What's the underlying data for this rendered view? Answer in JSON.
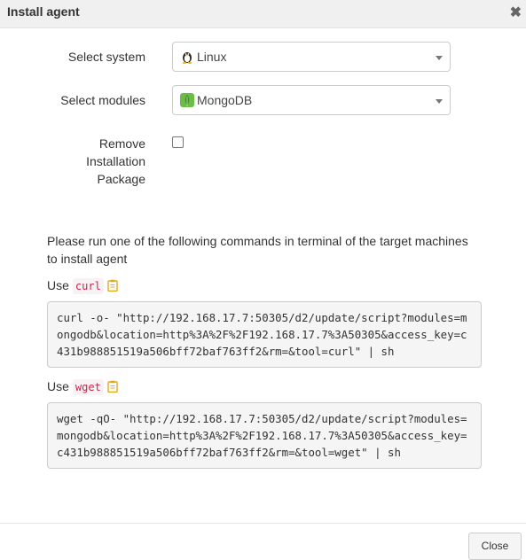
{
  "dialog": {
    "title": "Install agent",
    "close_icon": "close-icon"
  },
  "form": {
    "system_label": "Select system",
    "system_value": "Linux",
    "system_icon": "linux-penguin-icon",
    "modules_label": "Select modules",
    "modules_value": "MongoDB",
    "modules_icon": "mongodb-leaf-icon",
    "remove_label_line1": "Remove",
    "remove_label_line2": "Installation",
    "remove_label_line3": "Package",
    "remove_checked": false
  },
  "instructions": {
    "text": "Please run one of the following commands in terminal of the target machines to install agent",
    "curl": {
      "use_label": "Use",
      "tool": "curl",
      "command": "curl -o- \"http://192.168.17.7:50305/d2/update/script?modules=mongodb&location=http%3A%2F%2F192.168.17.7%3A50305&access_key=c431b988851519a506bff72baf763ff2&rm=&tool=curl\" | sh"
    },
    "wget": {
      "use_label": "Use",
      "tool": "wget",
      "command": "wget -qO- \"http://192.168.17.7:50305/d2/update/script?modules=mongodb&location=http%3A%2F%2F192.168.17.7%3A50305&access_key=c431b988851519a506bff72baf763ff2&rm=&tool=wget\" | sh"
    },
    "clipboard_icon": "clipboard-icon"
  },
  "footer": {
    "close_label": "Close"
  },
  "colors": {
    "code_text": "#c7254e",
    "clipboard": "#e6a817",
    "mongodb_green": "#4faa41"
  }
}
